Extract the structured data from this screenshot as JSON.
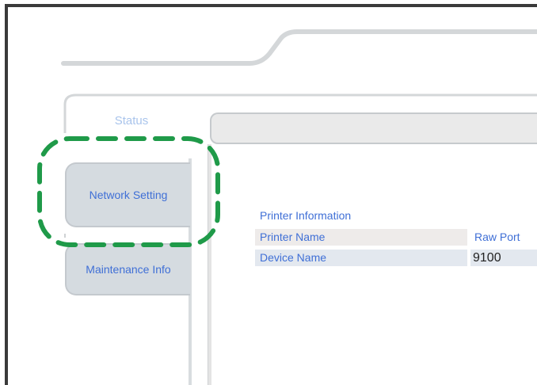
{
  "tabs": {
    "status_label": "Status",
    "network_setting_label": "Network Setting",
    "maintenance_info_label": "Maintenance Info"
  },
  "printer_info": {
    "heading": "Printer Information",
    "rows": [
      {
        "label": "Printer Name",
        "value": "Raw Port"
      },
      {
        "label": "Device Name",
        "value": "9100"
      }
    ]
  },
  "colors": {
    "highlight": "#1f9a49",
    "link_text": "#3f6fd6",
    "status_text": "#a9c4ec",
    "tab_fill": "#d5dbe0"
  }
}
